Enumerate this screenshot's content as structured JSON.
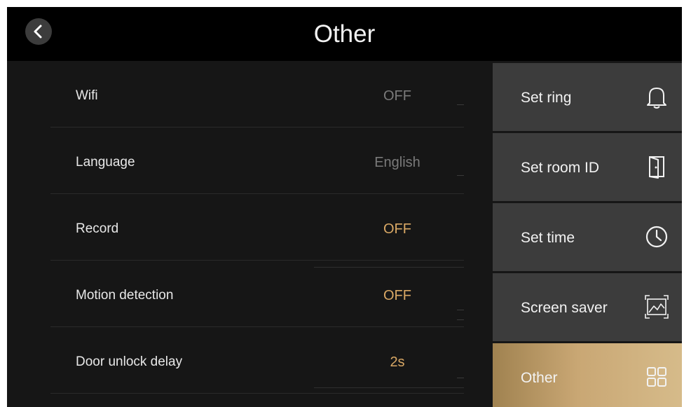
{
  "header": {
    "title": "Other",
    "back_icon": "chevron-left-icon"
  },
  "settings": [
    {
      "label": "Wifi",
      "value": "OFF",
      "value_color": "#7a7a7a"
    },
    {
      "label": "Language",
      "value": "English",
      "value_color": "#7a7a7a"
    },
    {
      "label": "Record",
      "value": "OFF",
      "value_color": "#d9a865"
    },
    {
      "label": "Motion detection",
      "value": "OFF",
      "value_color": "#d9a865"
    },
    {
      "label": "Door unlock delay",
      "value": "2s",
      "value_color": "#d9a865"
    }
  ],
  "nav": [
    {
      "label": "Set ring",
      "icon": "bell-icon",
      "active": false
    },
    {
      "label": "Set room ID",
      "icon": "door-icon",
      "active": false
    },
    {
      "label": "Set time",
      "icon": "clock-icon",
      "active": false
    },
    {
      "label": "Screen saver",
      "icon": "picture-icon",
      "active": false
    },
    {
      "label": "Other",
      "icon": "grid-icon",
      "active": true
    }
  ],
  "colors": {
    "background": "#161616",
    "topbar": "#000000",
    "nav_item": "#3c3c3c",
    "accent": "#d9a865",
    "active_gradient_start": "#a08250",
    "active_gradient_end": "#d6bb8a"
  }
}
